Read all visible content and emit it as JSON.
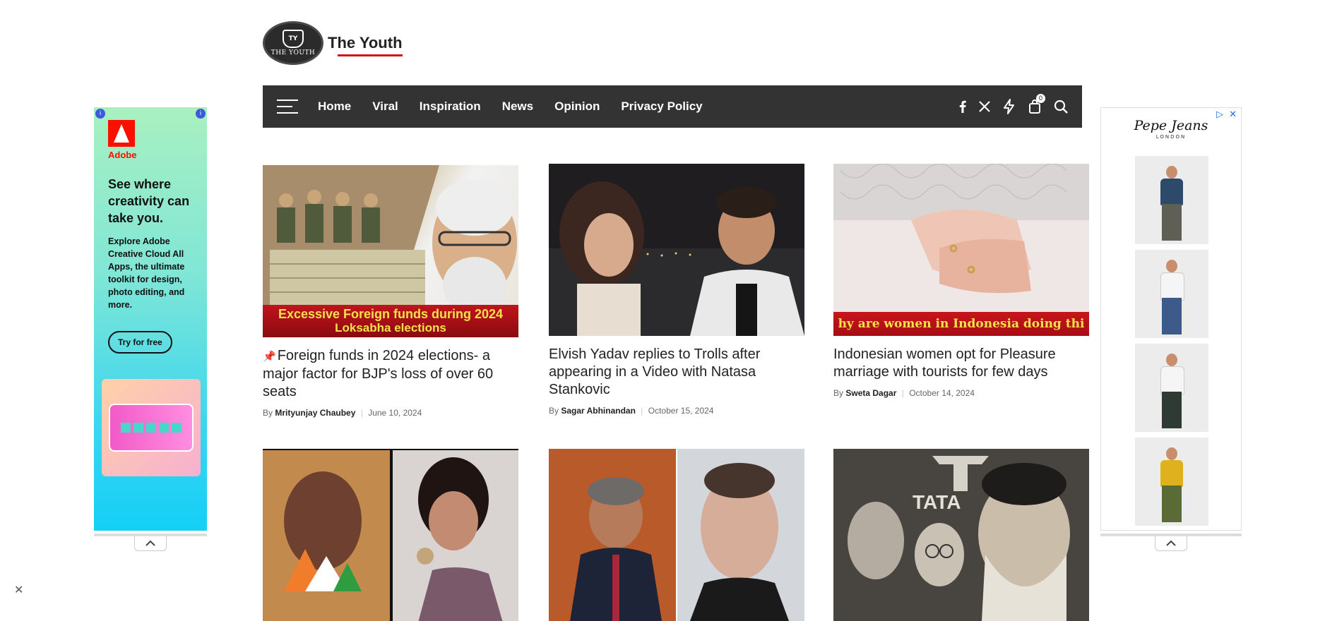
{
  "site": {
    "logo_badge_text": "THE YOUTH",
    "logo_monogram": "TY",
    "name": "The Youth"
  },
  "nav": {
    "items": [
      "Home",
      "Viral",
      "Inspiration",
      "News",
      "Opinion",
      "Privacy Policy"
    ],
    "cart_count": "0",
    "icons": [
      "facebook-icon",
      "x-icon",
      "bolt-icon",
      "cart-icon",
      "search-icon"
    ]
  },
  "ad_left": {
    "brand": "Adobe",
    "headline": "See where creativity can take you.",
    "body": "Explore Adobe Creative Cloud All Apps, the ultimate toolkit for design, photo editing, and more.",
    "cta": "Try for free"
  },
  "ad_right": {
    "brand": "Pepe Jeans",
    "brand_sub": "LONDON"
  },
  "articles": [
    {
      "title": "Foreign funds in 2024 elections- a major factor for BJP's loss of over 60 seats",
      "pinned": true,
      "by": "By",
      "author": "Mrityunjay Chaubey",
      "date": "June 10, 2024",
      "caption_line1": "Excessive Foreign funds during 2024",
      "caption_line2": "Loksabha elections"
    },
    {
      "title": "Elvish Yadav replies to Trolls after appearing in a Video with Natasa Stankovic",
      "pinned": false,
      "by": "By",
      "author": "Sagar Abhinandan",
      "date": "October 15, 2024"
    },
    {
      "title": "Indonesian women opt for Pleasure marriage with tourists for few days",
      "pinned": false,
      "by": "By",
      "author": "Sweta Dagar",
      "date": "October 14, 2024",
      "caption_line1": "hy are women in Indonesia doing thi"
    }
  ],
  "second_row_captions": {
    "tata": "TATA"
  },
  "colors": {
    "nav_bg": "#333333",
    "accent_red": "#d0141b"
  }
}
